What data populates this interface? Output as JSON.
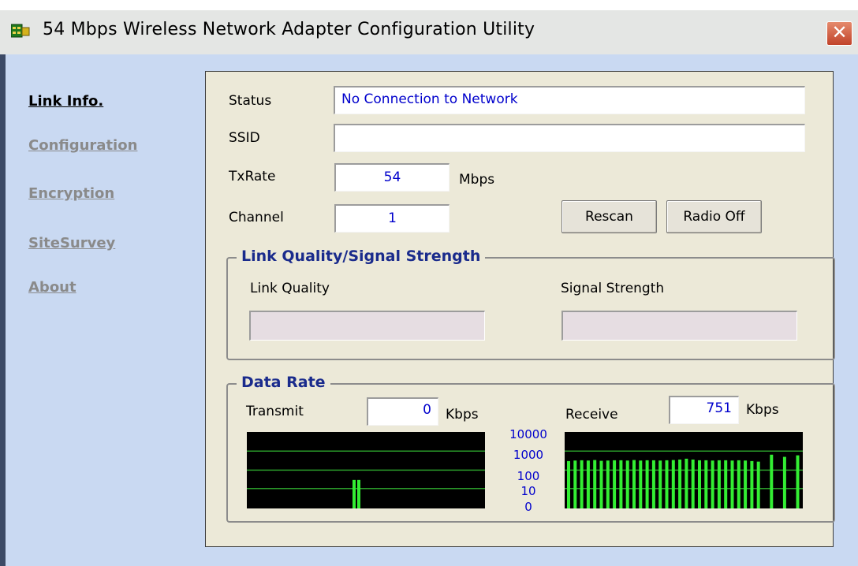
{
  "window": {
    "title": "54 Mbps Wireless Network Adapter Configuration Utility",
    "close_label": "✕"
  },
  "sidebar": {
    "items": [
      {
        "label": "Link Info.",
        "active": true
      },
      {
        "label": "Configuration",
        "active": false
      },
      {
        "label": "Encryption",
        "active": false
      },
      {
        "label": "SiteSurvey",
        "active": false
      },
      {
        "label": "About",
        "active": false
      }
    ]
  },
  "link_info": {
    "status_label": "Status",
    "status_value": "No Connection to Network",
    "ssid_label": "SSID",
    "ssid_value": "",
    "txrate_label": "TxRate",
    "txrate_value": "54",
    "txrate_unit": "Mbps",
    "channel_label": "Channel",
    "channel_value": "1",
    "rescan_label": "Rescan",
    "radio_off_label": "Radio Off"
  },
  "quality": {
    "group_title": "Link Quality/Signal Strength",
    "link_quality_label": "Link Quality",
    "signal_strength_label": "Signal Strength"
  },
  "data_rate": {
    "group_title": "Data Rate",
    "transmit_label": "Transmit",
    "transmit_value": "0",
    "transmit_unit": "Kbps",
    "receive_label": "Receive",
    "receive_value": "751",
    "receive_unit": "Kbps",
    "scale_labels": [
      "10000",
      "1000",
      "100",
      "10",
      "0"
    ],
    "colors": {
      "bar": "#33ee33",
      "grid": "#2a9a2a",
      "background": "#000000"
    }
  },
  "chart_data": [
    {
      "type": "bar",
      "name": "Transmit",
      "scale": "log",
      "ylim": [
        0,
        10000
      ],
      "values": [
        0,
        0,
        0,
        0,
        0,
        0,
        0,
        0,
        0,
        0,
        0,
        0,
        0,
        0,
        0,
        0,
        0,
        0,
        0,
        0,
        0,
        0,
        0,
        0,
        0,
        0,
        0,
        0,
        0,
        30,
        30,
        0,
        0,
        0,
        0,
        0,
        0,
        0,
        0,
        0,
        0,
        0,
        0,
        0,
        0,
        0,
        0,
        0,
        0,
        0
      ]
    },
    {
      "type": "bar",
      "name": "Receive",
      "scale": "log",
      "ylim": [
        0,
        10000
      ],
      "values": [
        300,
        320,
        330,
        320,
        340,
        310,
        320,
        330,
        330,
        320,
        340,
        320,
        330,
        330,
        320,
        330,
        340,
        360,
        400,
        360,
        330,
        330,
        320,
        330,
        330,
        320,
        330,
        320,
        300,
        280,
        0,
        650,
        0,
        500,
        0,
        600
      ]
    }
  ]
}
